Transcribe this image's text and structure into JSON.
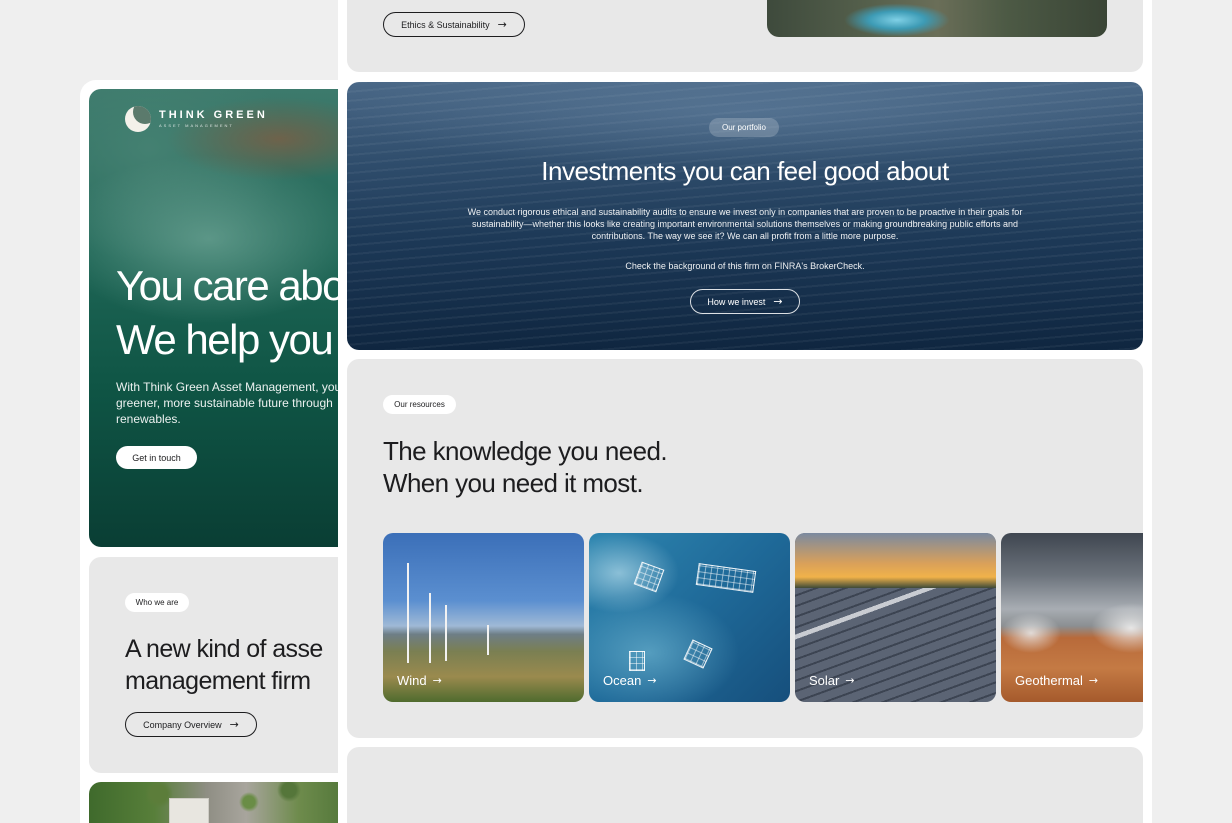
{
  "brand": {
    "name": "THINK GREEN",
    "tagline": "ASSET MANAGEMENT"
  },
  "hero": {
    "title_line1": "You care abo",
    "title_line2": "We help you",
    "description": "With Think Green Asset Management, you greener, more sustainable future through renewables.",
    "cta_label": "Get in touch"
  },
  "who_we_are": {
    "pill": "Who we are",
    "title_line1": "A new kind of asse",
    "title_line2": "management firm",
    "button_label": "Company Overview"
  },
  "ethics": {
    "button_label": "Ethics & Sustainability"
  },
  "portfolio": {
    "pill": "Our portfolio",
    "title": "Investments you can feel good about",
    "description": "We conduct rigorous ethical and sustainability audits to ensure we invest only in companies that are proven to be proactive in their goals for sustainability—whether this looks like creating important environmental solutions themselves or making groundbreaking public efforts and contributions. The way we see it? We can all profit from a little more purpose.",
    "check_text": "Check the background of this firm on FINRA's BrokerCheck.",
    "button_label": "How we invest"
  },
  "resources": {
    "pill": "Our resources",
    "title_line1": "The knowledge you need.",
    "title_line2": "When you need it most.",
    "tiles": [
      {
        "label": "Wind"
      },
      {
        "label": "Ocean"
      },
      {
        "label": "Solar"
      },
      {
        "label": "Geothermal"
      }
    ]
  },
  "icons": {
    "arrow": "arrow-right-icon",
    "logo": "moon-logo-icon"
  },
  "colors": {
    "hero_green": "#0f5545",
    "ocean_blue": "#1c3856",
    "card_grey": "#e8e8e8",
    "page_bg": "#efefef"
  }
}
